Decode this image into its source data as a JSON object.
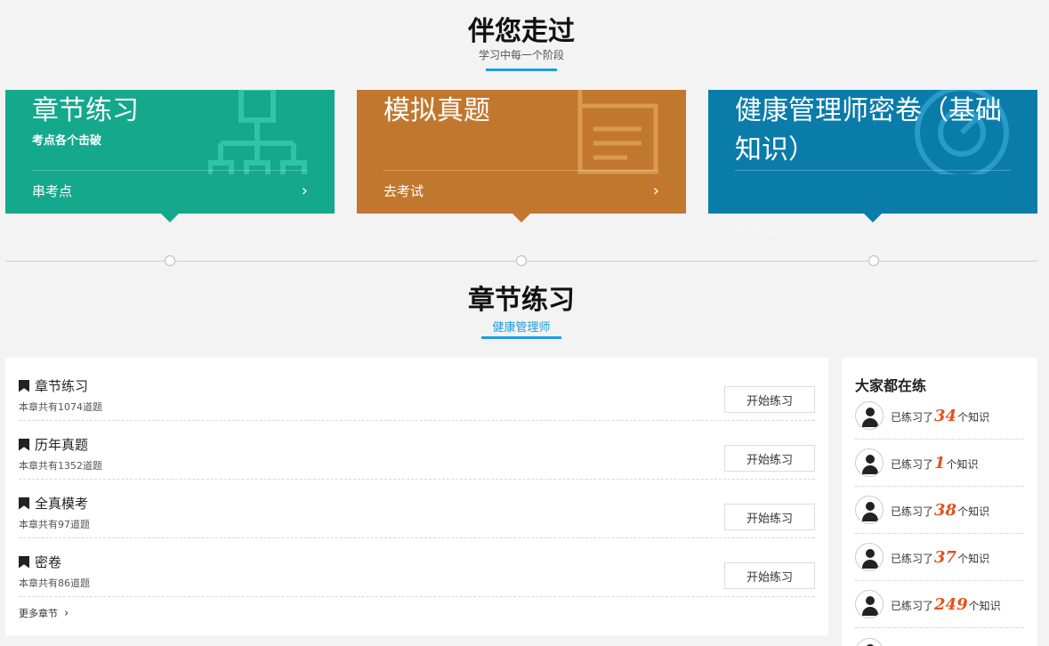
{
  "hero": {
    "title": "伴您走过",
    "subtitle": "学习中每一个阶段"
  },
  "cards": [
    {
      "title": "章节练习",
      "desc": "考点各个击破",
      "link": "串考点",
      "color": "#14a88c",
      "icon": "org-chart-icon"
    },
    {
      "title": "模拟真题",
      "desc": "",
      "link": "去考试",
      "color": "#c2772f",
      "icon": "document-icon"
    },
    {
      "title": "健康管理师密卷（基础知识）",
      "desc": "",
      "link": "去考试",
      "color": "#0a7caa",
      "icon": "target-icon"
    }
  ],
  "section": {
    "title": "章节练习",
    "subtitle": "健康管理师"
  },
  "chapters": [
    {
      "name": "章节练习",
      "count": "本章共有1074道题",
      "button": "开始练习"
    },
    {
      "name": "历年真题",
      "count": "本章共有1352道题",
      "button": "开始练习"
    },
    {
      "name": "全真模考",
      "count": "本章共有97道题",
      "button": "开始练习"
    },
    {
      "name": "密卷",
      "count": "本章共有86道题",
      "button": "开始练习"
    }
  ],
  "more": "更多章节",
  "sidebar": {
    "title": "大家都在练",
    "prefix": "已练习了",
    "suffix": "个知识",
    "items": [
      {
        "num": "34"
      },
      {
        "num": "1"
      },
      {
        "num": "38"
      },
      {
        "num": "37"
      },
      {
        "num": "249"
      }
    ]
  }
}
